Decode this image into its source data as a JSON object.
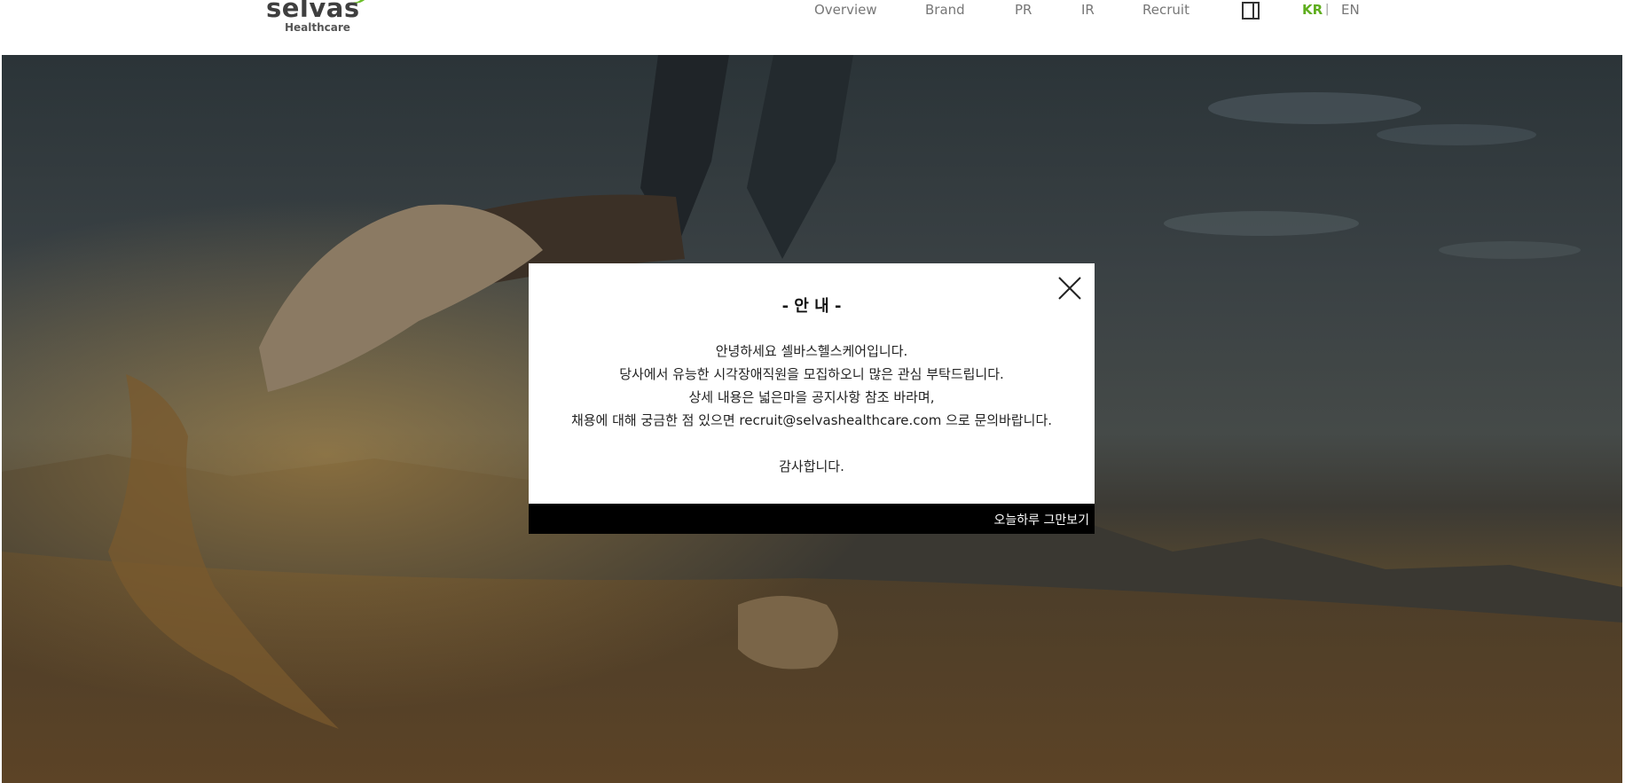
{
  "header": {
    "logo": {
      "wordmark": "selvas",
      "subtitle": "Healthcare",
      "leaf_color": "#6cbf2a"
    },
    "nav": [
      {
        "label": "Overview"
      },
      {
        "label": "Brand"
      },
      {
        "label": "PR"
      },
      {
        "label": "IR"
      },
      {
        "label": "Recruit"
      }
    ],
    "sitemap_icon": "square-icon",
    "languages": {
      "kr": "KR",
      "separator": "|",
      "en": "EN",
      "active_color": "#5fae1e"
    }
  },
  "modal": {
    "title": "- 안 내 -",
    "lines": [
      "안녕하세요 셀바스헬스케어입니다.",
      "당사에서 유능한 시각장애직원을 모집하오니 많은 관심 부탁드립니다.",
      "상세 내용은 넓은마을 공지사항 참조 바라며,",
      "채용에 대해 궁금한 점 있으면 recruit@selvashealthcare.com 으로 문의바랍니다."
    ],
    "closing": "감사합니다.",
    "close_icon": "close-icon",
    "footer_label": "오늘하루 그만보기"
  }
}
